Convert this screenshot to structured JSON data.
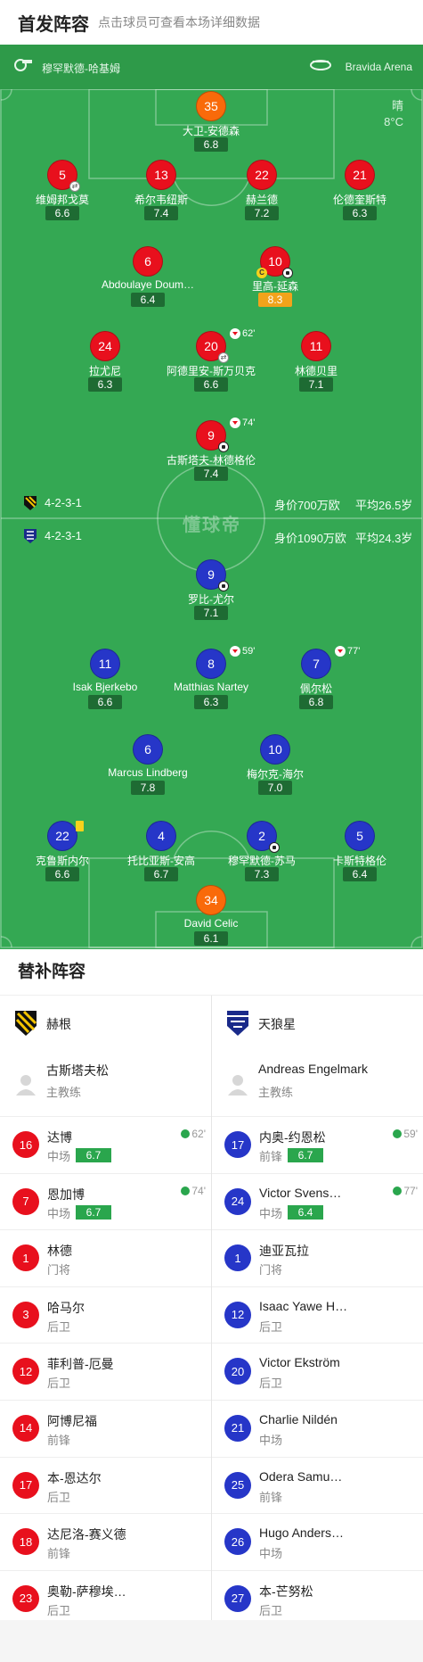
{
  "header": {
    "title": "首发阵容",
    "hint": "点击球员可查看本场详细数据"
  },
  "match_info": {
    "coach": "穆罕默德-哈基姆",
    "stadium": "Bravida Arena",
    "weather": "晴",
    "temperature": "8°C",
    "watermark": "懂球帝"
  },
  "home_formation": {
    "formation": "4-2-3-1",
    "value": "身价700万欧",
    "age": "平均26.5岁"
  },
  "away_formation": {
    "formation": "4-2-3-1",
    "value": "身价1090万欧",
    "age": "平均24.3岁"
  },
  "home_players": [
    {
      "num": "35",
      "name": "大卫-安德森",
      "rating": "6.8"
    },
    {
      "num": "5",
      "name": "维姆邦戈莫",
      "rating": "6.6"
    },
    {
      "num": "13",
      "name": "希尔韦纽斯",
      "rating": "7.4"
    },
    {
      "num": "22",
      "name": "赫兰德",
      "rating": "7.2"
    },
    {
      "num": "21",
      "name": "伦德奎斯特",
      "rating": "6.3"
    },
    {
      "num": "6",
      "name": "Abdoulaye Doum…",
      "rating": "6.4"
    },
    {
      "num": "10",
      "name": "里高-延森",
      "rating": "8.3"
    },
    {
      "num": "24",
      "name": "拉尤尼",
      "rating": "6.3"
    },
    {
      "num": "20",
      "name": "阿德里安-斯万贝克",
      "rating": "6.6",
      "sub_min": "62'"
    },
    {
      "num": "11",
      "name": "林德贝里",
      "rating": "7.1"
    },
    {
      "num": "9",
      "name": "古斯塔夫-林德格伦",
      "rating": "7.4",
      "sub_min": "74'"
    }
  ],
  "away_players": [
    {
      "num": "9",
      "name": "罗比-尤尔",
      "rating": "7.1"
    },
    {
      "num": "11",
      "name": "Isak Bjerkebo",
      "rating": "6.6"
    },
    {
      "num": "8",
      "name": "Matthias Nartey",
      "rating": "6.3",
      "sub_min": "59'"
    },
    {
      "num": "7",
      "name": "佩尔松",
      "rating": "6.8",
      "sub_min": "77'"
    },
    {
      "num": "6",
      "name": "Marcus Lindberg",
      "rating": "7.8"
    },
    {
      "num": "10",
      "name": "梅尔克-海尔",
      "rating": "7.0"
    },
    {
      "num": "22",
      "name": "克鲁斯内尔",
      "rating": "6.6"
    },
    {
      "num": "4",
      "name": "托比亚斯-安高",
      "rating": "6.7"
    },
    {
      "num": "2",
      "name": "穆罕默德-苏马",
      "rating": "7.3"
    },
    {
      "num": "5",
      "name": "卡斯特格伦",
      "rating": "6.4"
    },
    {
      "num": "34",
      "name": "David Celic",
      "rating": "6.1"
    }
  ],
  "subs_title": "替补阵容",
  "home_subs": {
    "team": "赫根",
    "coach": "古斯塔夫松",
    "coach_role": "主教练",
    "players": [
      {
        "num": "16",
        "name": "达博",
        "pos": "中场",
        "rating": "6.7",
        "min": "62'"
      },
      {
        "num": "7",
        "name": "恩加博",
        "pos": "中场",
        "rating": "6.7",
        "min": "74'"
      },
      {
        "num": "1",
        "name": "林德",
        "pos": "门将"
      },
      {
        "num": "3",
        "name": "哈马尔",
        "pos": "后卫"
      },
      {
        "num": "12",
        "name": "菲利普-厄曼",
        "pos": "后卫"
      },
      {
        "num": "14",
        "name": "阿博尼福",
        "pos": "前锋"
      },
      {
        "num": "17",
        "name": "本-恩达尔",
        "pos": "后卫"
      },
      {
        "num": "18",
        "name": "达尼洛-赛义德",
        "pos": "前锋"
      },
      {
        "num": "23",
        "name": "奥勒-萨穆埃…",
        "pos": "后卫"
      }
    ]
  },
  "away_subs": {
    "team": "天狼星",
    "coach": "Andreas Engelmark",
    "coach_role": "主教练",
    "players": [
      {
        "num": "17",
        "name": "内奥-约恩松",
        "pos": "前锋",
        "rating": "6.7",
        "min": "59'"
      },
      {
        "num": "24",
        "name": "Victor Svens…",
        "pos": "中场",
        "rating": "6.4",
        "min": "77'"
      },
      {
        "num": "1",
        "name": "迪亚瓦拉",
        "pos": "门将"
      },
      {
        "num": "12",
        "name": "Isaac Yawe H…",
        "pos": "后卫"
      },
      {
        "num": "20",
        "name": "Victor Ekström",
        "pos": "后卫"
      },
      {
        "num": "21",
        "name": "Charlie Nildén",
        "pos": "中场"
      },
      {
        "num": "25",
        "name": "Odera Samu…",
        "pos": "前锋"
      },
      {
        "num": "26",
        "name": "Hugo Anders…",
        "pos": "中场"
      },
      {
        "num": "27",
        "name": "本-芒努松",
        "pos": "后卫"
      }
    ]
  }
}
